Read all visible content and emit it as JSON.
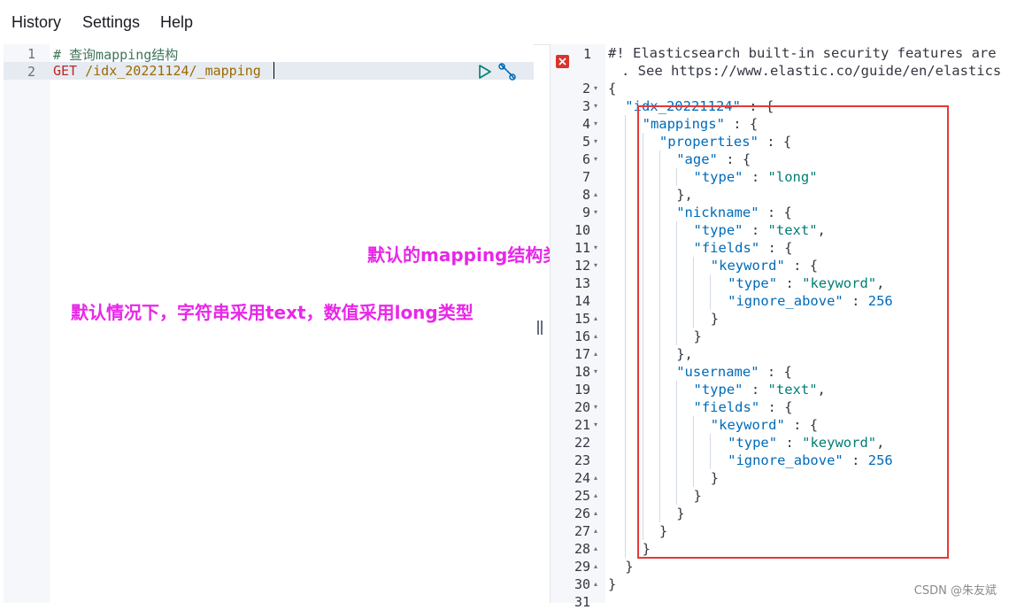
{
  "menu": {
    "history": "History",
    "settings": "Settings",
    "help": "Help"
  },
  "editor": {
    "lines": [
      {
        "num": "1",
        "text": "# 查询mapping结构"
      },
      {
        "num": "2",
        "method": "GET",
        "url": "/idx_20221124/_mapping"
      }
    ]
  },
  "annotations": {
    "default_mapping": "默认的mapping结构类型",
    "default_types": "默认情况下，字符串采用text，数值采用long类型"
  },
  "response": {
    "warning_line1": "#! Elasticsearch built-in security features are",
    "warning_line2": ". See https://www.elastic.co/guide/en/elastics",
    "lines": [
      {
        "num": "2",
        "fold": "▾",
        "text": "{"
      },
      {
        "num": "3",
        "fold": "▾",
        "key": "idx_20221124",
        "rest": " : {"
      },
      {
        "num": "4",
        "fold": "▾",
        "key": "mappings",
        "rest": " : {"
      },
      {
        "num": "5",
        "fold": "▾",
        "key": "properties",
        "rest": " : {"
      },
      {
        "num": "6",
        "fold": "▾",
        "key": "age",
        "rest": " : {"
      },
      {
        "num": "7",
        "fold": "",
        "key": "type",
        "rest": " : ",
        "str": "long"
      },
      {
        "num": "8",
        "fold": "▴",
        "text": "},"
      },
      {
        "num": "9",
        "fold": "▾",
        "key": "nickname",
        "rest": " : {"
      },
      {
        "num": "10",
        "fold": "",
        "key": "type",
        "rest": " : ",
        "str": "text",
        "tail": ","
      },
      {
        "num": "11",
        "fold": "▾",
        "key": "fields",
        "rest": " : {"
      },
      {
        "num": "12",
        "fold": "▾",
        "key": "keyword",
        "rest": " : {"
      },
      {
        "num": "13",
        "fold": "",
        "key": "type",
        "rest": " : ",
        "str": "keyword",
        "tail": ","
      },
      {
        "num": "14",
        "fold": "",
        "key": "ignore_above",
        "rest": " : ",
        "num_val": "256"
      },
      {
        "num": "15",
        "fold": "▴",
        "text": "}"
      },
      {
        "num": "16",
        "fold": "▴",
        "text": "}"
      },
      {
        "num": "17",
        "fold": "▴",
        "text": "},"
      },
      {
        "num": "18",
        "fold": "▾",
        "key": "username",
        "rest": " : {"
      },
      {
        "num": "19",
        "fold": "",
        "key": "type",
        "rest": " : ",
        "str": "text",
        "tail": ","
      },
      {
        "num": "20",
        "fold": "▾",
        "key": "fields",
        "rest": " : {"
      },
      {
        "num": "21",
        "fold": "▾",
        "key": "keyword",
        "rest": " : {"
      },
      {
        "num": "22",
        "fold": "",
        "key": "type",
        "rest": " : ",
        "str": "keyword",
        "tail": ","
      },
      {
        "num": "23",
        "fold": "",
        "key": "ignore_above",
        "rest": " : ",
        "num_val": "256"
      },
      {
        "num": "24",
        "fold": "▴",
        "text": "}"
      },
      {
        "num": "25",
        "fold": "▴",
        "text": "}"
      },
      {
        "num": "26",
        "fold": "▴",
        "text": "}"
      },
      {
        "num": "27",
        "fold": "▴",
        "text": "}"
      },
      {
        "num": "28",
        "fold": "▴",
        "text": "}"
      },
      {
        "num": "29",
        "fold": "▴",
        "text": "}"
      },
      {
        "num": "30",
        "fold": "▴",
        "text": "}"
      },
      {
        "num": "31",
        "fold": "",
        "text": ""
      }
    ]
  },
  "watermark": "CSDN @朱友斌"
}
